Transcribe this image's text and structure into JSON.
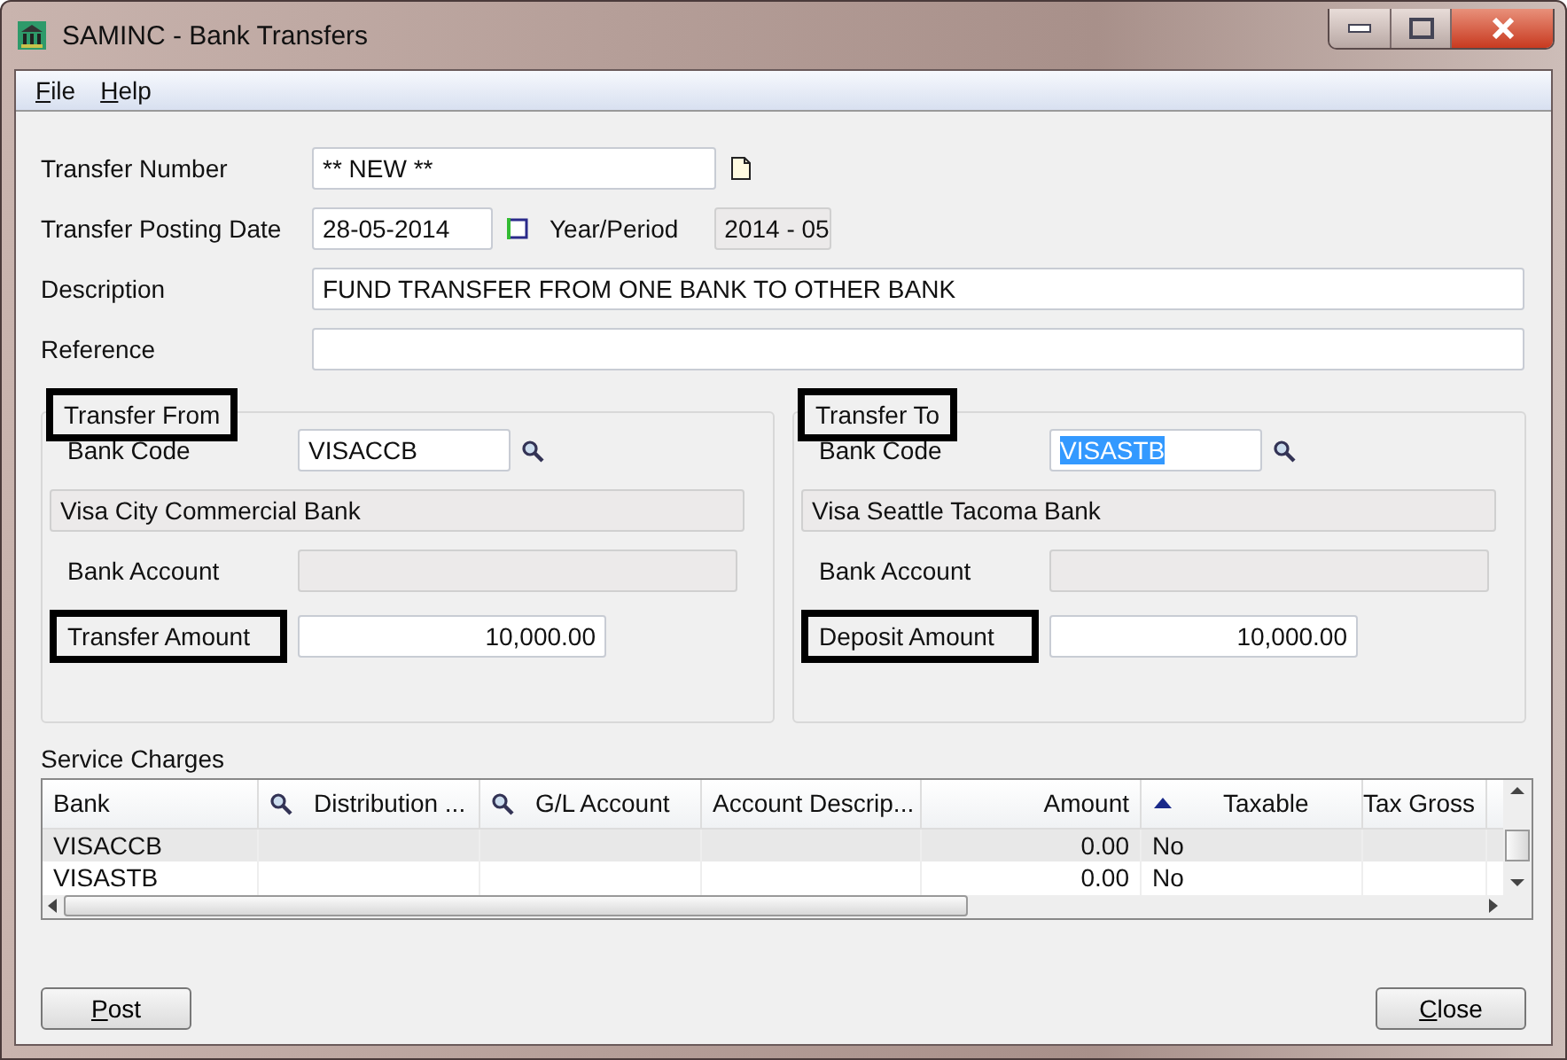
{
  "window": {
    "title": "SAMINC - Bank Transfers"
  },
  "menu": [
    {
      "label": "File"
    },
    {
      "label": "Help"
    }
  ],
  "transfer_number": {
    "label": "Transfer Number",
    "value": "** NEW **"
  },
  "posting_date": {
    "label": "Transfer Posting Date",
    "value": "28-05-2014"
  },
  "year_period": {
    "label": "Year/Period",
    "value": "2014 - 05"
  },
  "description": {
    "label": "Description",
    "value": "FUND TRANSFER FROM ONE BANK TO OTHER BANK"
  },
  "reference": {
    "label": "Reference"
  },
  "groups": [
    {
      "title": "Transfer From",
      "highlighted": true,
      "bank_code_label": "Bank Code",
      "bank_code": "VISACCB",
      "code_selected": false,
      "bank_name": "Visa City Commercial Bank",
      "account_label": "Bank Account",
      "amount_label": "Transfer Amount",
      "amount_highlighted": true,
      "amount": "10,000.00"
    },
    {
      "title": "Transfer To",
      "highlighted": true,
      "bank_code_label": "Bank Code",
      "bank_code": "VISASTB",
      "code_selected": true,
      "bank_name": "Visa Seattle Tacoma Bank",
      "account_label": "Bank Account",
      "amount_label": "Deposit Amount",
      "amount_highlighted": true,
      "amount": "10,000.00"
    }
  ],
  "service_charges": {
    "label": "Service Charges",
    "columns": [
      {
        "label": "Bank",
        "kind": "plain"
      },
      {
        "label": "Distribution ...",
        "kind": "search"
      },
      {
        "label": "G/L Account",
        "kind": "search"
      },
      {
        "label": "Account Descrip...",
        "kind": "plain"
      },
      {
        "label": "Amount",
        "kind": "number"
      },
      {
        "label": "Taxable",
        "kind": "sorted"
      },
      {
        "label": "Tax Gross",
        "kind": "number"
      }
    ],
    "rows": [
      {
        "selected": true,
        "cells": [
          "VISACCB",
          "",
          "",
          "",
          "0.00",
          "No",
          ""
        ]
      },
      {
        "selected": false,
        "cells": [
          "VISASTB",
          "",
          "",
          "",
          "0.00",
          "No",
          ""
        ]
      }
    ]
  },
  "buttons": [
    {
      "label": "Post"
    },
    {
      "label": "Close"
    }
  ]
}
